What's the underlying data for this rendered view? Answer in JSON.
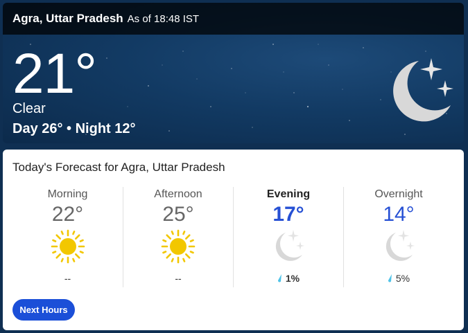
{
  "hero": {
    "location": "Agra, Uttar Pradesh",
    "as_of": "As of 18:48 IST",
    "temperature": "21°",
    "condition": "Clear",
    "day_night": "Day 26° • Night 12°",
    "icon": "moon-stars-icon"
  },
  "forecast": {
    "title": "Today's Forecast for Agra, Uttar Pradesh",
    "periods": [
      {
        "label": "Morning",
        "temp": "22°",
        "icon": "sun-icon",
        "precip": "--"
      },
      {
        "label": "Afternoon",
        "temp": "25°",
        "icon": "sun-icon",
        "precip": "--"
      },
      {
        "label": "Evening",
        "temp": "17°",
        "icon": "moon-stars-icon",
        "precip": "1%"
      },
      {
        "label": "Overnight",
        "temp": "14°",
        "icon": "moon-stars-icon",
        "precip": "5%"
      }
    ],
    "button_label": "Next Hours"
  },
  "colors": {
    "accent": "#1b4fd8",
    "sun": "#f2c700",
    "moon": "#d8d8d8",
    "drop": "#4fc3e8"
  }
}
